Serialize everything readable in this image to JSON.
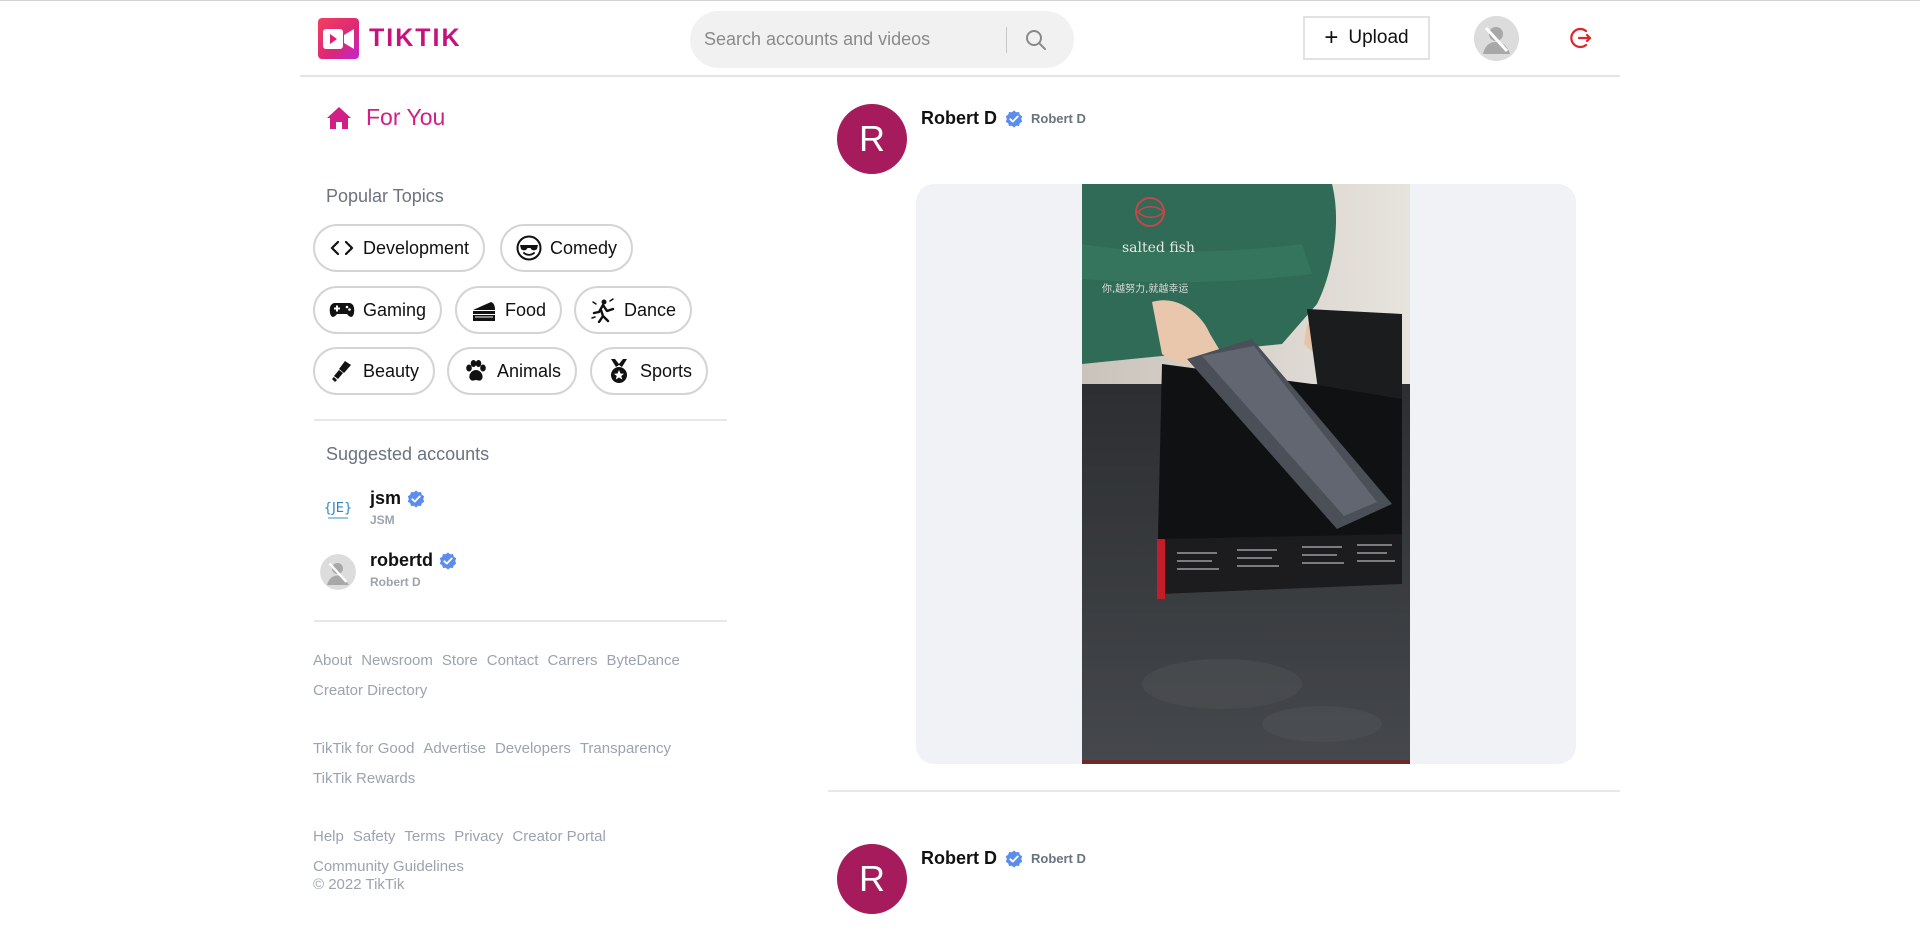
{
  "brand": {
    "name": "TIKTIK",
    "accent": "#c8127b",
    "accent_pink": "#d11f86"
  },
  "navbar": {
    "search": {
      "placeholder": "Search accounts and videos",
      "icon": "search-icon"
    },
    "upload_label": "Upload",
    "upload_icon": "plus-icon",
    "avatar_icon": "user-avatar-icon",
    "logout_icon": "logout-icon"
  },
  "sidebar": {
    "nav": {
      "for_you_label": "For You",
      "icon": "home-icon"
    },
    "popular_topics_title": "Popular Topics",
    "topics": [
      {
        "label": "Development",
        "icon": "code-icon"
      },
      {
        "label": "Comedy",
        "icon": "sunglasses-emoji-icon"
      },
      {
        "label": "Gaming",
        "icon": "gamepad-icon"
      },
      {
        "label": "Food",
        "icon": "cake-icon"
      },
      {
        "label": "Dance",
        "icon": "dance-icon"
      },
      {
        "label": "Beauty",
        "icon": "lipstick-icon"
      },
      {
        "label": "Animals",
        "icon": "paw-icon"
      },
      {
        "label": "Sports",
        "icon": "medal-icon"
      }
    ],
    "suggested_title": "Suggested accounts",
    "accounts": [
      {
        "username": "jsm",
        "display_name": "JSM",
        "verified": true
      },
      {
        "username": "robertd",
        "display_name": "Robert D",
        "verified": true
      }
    ],
    "footer": {
      "group1": [
        "About",
        "Newsroom",
        "Store",
        "Contact",
        "Carrers",
        "ByteDance",
        "Creator Directory"
      ],
      "group2": [
        "TikTik for Good",
        "Advertise",
        "Developers",
        "Transparency",
        "TikTik Rewards"
      ],
      "group3": [
        "Help",
        "Safety",
        "Terms",
        "Privacy",
        "Creator Portal",
        "Community Guidelines"
      ],
      "copyright": "© 2022 TikTik"
    }
  },
  "feed": {
    "posts": [
      {
        "avatar_letter": "R",
        "name": "Robert D",
        "handle": "Robert D",
        "verified": true
      },
      {
        "avatar_letter": "R",
        "name": "Robert D",
        "handle": "Robert D",
        "verified": true
      }
    ]
  }
}
